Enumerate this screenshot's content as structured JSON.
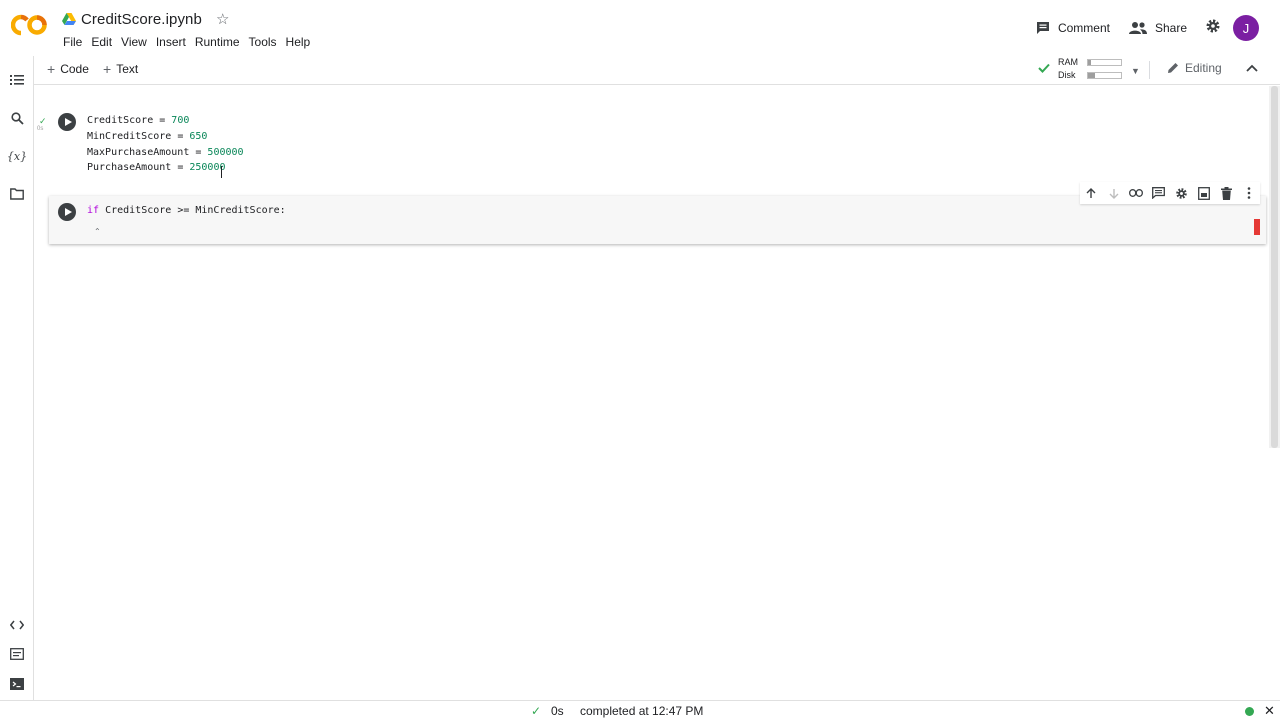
{
  "app": {
    "logo_text": "CO",
    "file_name": "CreditScore.ipynb",
    "accent_orange": "#f9ab00",
    "accent_purple": "#7b1fa2"
  },
  "menu": [
    "File",
    "Edit",
    "View",
    "Insert",
    "Runtime",
    "Tools",
    "Help"
  ],
  "header_actions": {
    "comment": "Comment",
    "share": "Share",
    "avatar_letter": "J"
  },
  "toolbar": {
    "add_code": "Code",
    "add_text": "Text",
    "ram_label": "RAM",
    "disk_label": "Disk",
    "ram_usage": 0.1,
    "disk_usage": 0.22,
    "mode": "Editing"
  },
  "cells": [
    {
      "status_time": "0s",
      "lines": [
        {
          "name": "CreditScore",
          "op": " = ",
          "value": "700"
        },
        {
          "name": "MinCreditScore",
          "op": " = ",
          "value": "650"
        },
        {
          "name": "MaxPurchaseAmount",
          "op": " = ",
          "value": "500000"
        },
        {
          "name": "PurchaseAmount",
          "op": " = ",
          "value": "250000"
        }
      ]
    },
    {
      "keyword": "if",
      "expression": " CreditScore >= MinCreditScore:"
    }
  ],
  "status_bar": {
    "duration": "0s",
    "message": "completed at 12:47 PM"
  }
}
